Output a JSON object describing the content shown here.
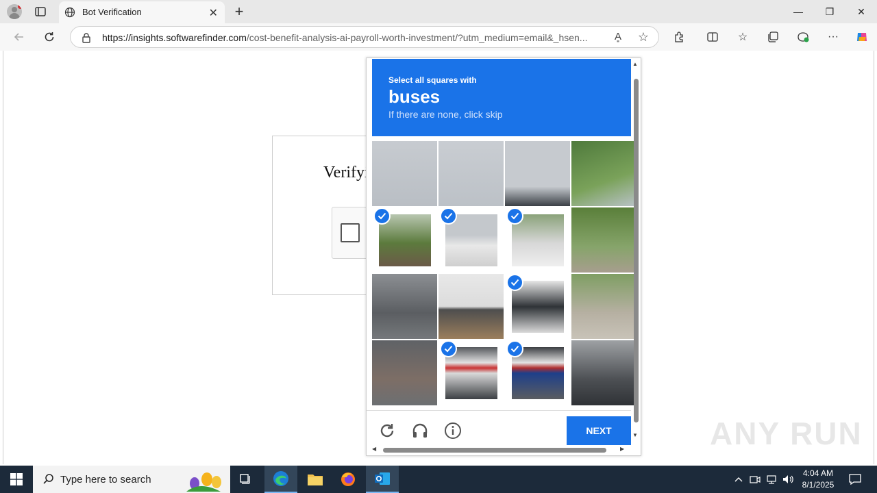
{
  "browser": {
    "tab_title": "Bot Verification",
    "url_host": "https://insights.softwarefinder.com",
    "url_path": "/cost-benefit-analysis-ai-payroll-worth-investment/?utm_medium=email&_hsen..."
  },
  "page": {
    "verify_title": "Verifyi"
  },
  "captcha": {
    "instruction": "Select all squares with",
    "target": "buses",
    "hint": "If there are none, click skip",
    "next_label": "NEXT",
    "selected_tiles": [
      4,
      5,
      6,
      10,
      13,
      14
    ],
    "accent_color": "#1a73e8"
  },
  "taskbar": {
    "search_placeholder": "Type here to search",
    "time": "4:04 AM",
    "date": "8/1/2025"
  },
  "watermark": "ANY RUN"
}
